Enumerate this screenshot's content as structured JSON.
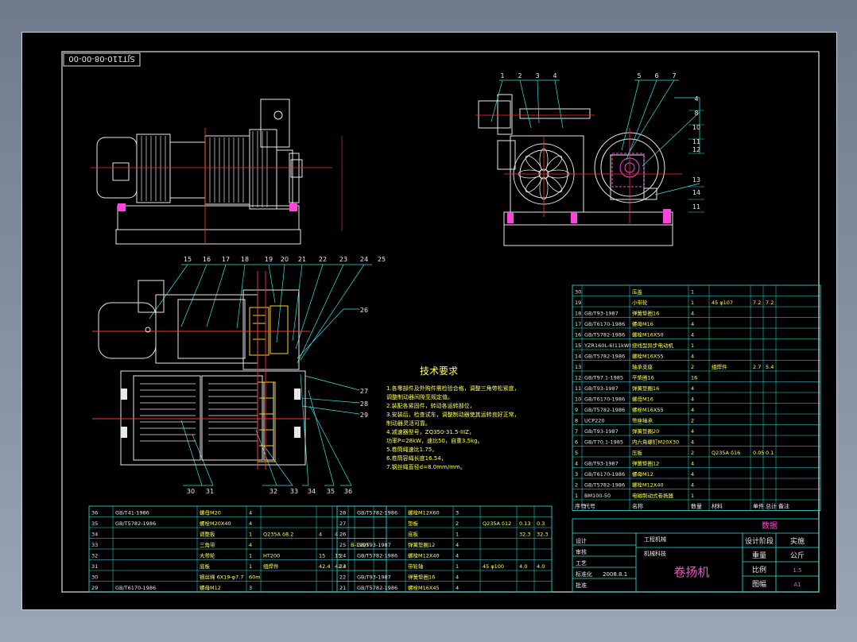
{
  "drawing_number": "SJT110-08-00-00",
  "balloons_top_left": [
    "1",
    "2",
    "3",
    "4"
  ],
  "balloons_top_mid": [
    "5",
    "6",
    "7"
  ],
  "balloons_right_side": [
    "4",
    "8",
    "10",
    "11",
    "12",
    "13",
    "14",
    "11"
  ],
  "balloons_plan_top": [
    "15",
    "16",
    "17",
    "18",
    "19",
    "20",
    "21",
    "22",
    "23",
    "24",
    "25"
  ],
  "balloons_plan_right": [
    "26",
    "27",
    "28",
    "29"
  ],
  "balloons_plan_bottom": [
    "30",
    "31",
    "32",
    "33",
    "34",
    "35",
    "36"
  ],
  "tech_req": {
    "title": "技术要求",
    "lines": [
      "1.各零部件及外购件需检验合格，调整三角带松紧度，",
      "  调整制动器间隙至规定值。",
      "2.装配各紧固件，转动各运转部位，",
      "3.安装后，检查试车，调整制动器使其运转良好正常，",
      "  制动器灵活可靠。",
      "4.减速器型号，ZQ350-31.5-IIIZ，",
      "  功率P=28kW，速比50，自重3.5kg。",
      "5.卷筒绳速比1.75，",
      "6.卷筒容绳长度16.54，",
      "7.钢丝绳直径d=8.0mm/mm。"
    ]
  },
  "bom_right": [
    {
      "no": "30",
      "code": "",
      "name": "压盖",
      "qty": "1",
      "mat": "",
      "w1": "",
      "w2": ""
    },
    {
      "no": "19",
      "code": "",
      "name": "小带轮",
      "qty": "1",
      "mat": "45 φ107",
      "w1": "7.2",
      "w2": "7.2"
    },
    {
      "no": "18",
      "code": "GB/T93-1987",
      "name": "弹簧垫圈16",
      "qty": "4",
      "mat": "",
      "w1": "",
      "w2": ""
    },
    {
      "no": "17",
      "code": "GB/T6170-1986",
      "name": "螺母M16",
      "qty": "4",
      "mat": "",
      "w1": "",
      "w2": ""
    },
    {
      "no": "16",
      "code": "GB/T5782-1986",
      "name": "螺栓M16X50",
      "qty": "4",
      "mat": "",
      "w1": "",
      "w2": ""
    },
    {
      "no": "15",
      "code": "YZR160L-6(11kW)",
      "name": "绕线型异步电动机",
      "qty": "1",
      "mat": "",
      "w1": "",
      "w2": ""
    },
    {
      "no": "14",
      "code": "GB/T5782-1986",
      "name": "螺栓M16X55",
      "qty": "4",
      "mat": "",
      "w1": "",
      "w2": ""
    },
    {
      "no": "13",
      "code": "",
      "name": "轴承支座",
      "qty": "2",
      "mat": "组焊件",
      "w1": "2.7",
      "w2": "5.4"
    },
    {
      "no": "12",
      "code": "GB/T97.1-1985",
      "name": "平垫圈16",
      "qty": "16",
      "mat": "",
      "w1": "",
      "w2": ""
    },
    {
      "no": "11",
      "code": "GB/T93-1987",
      "name": "弹簧垫圈16",
      "qty": "4",
      "mat": "",
      "w1": "",
      "w2": ""
    },
    {
      "no": "10",
      "code": "GB/T6170-1986",
      "name": "螺母M16",
      "qty": "4",
      "mat": "",
      "w1": "",
      "w2": ""
    },
    {
      "no": "9",
      "code": "GB/T5782-1986",
      "name": "螺栓M16X55",
      "qty": "4",
      "mat": "",
      "w1": "",
      "w2": ""
    },
    {
      "no": "8",
      "code": "UCP220",
      "name": "带座轴承",
      "qty": "2",
      "mat": "",
      "w1": "",
      "w2": ""
    },
    {
      "no": "7",
      "code": "GB/T93-1987",
      "name": "弹簧垫圈20",
      "qty": "4",
      "mat": "",
      "w1": "",
      "w2": ""
    },
    {
      "no": "6",
      "code": "GB/T70.1-1985",
      "name": "内六角螺钉M20X30",
      "qty": "4",
      "mat": "",
      "w1": "",
      "w2": ""
    },
    {
      "no": "5",
      "code": "",
      "name": "压板",
      "qty": "2",
      "mat": "Q235A δ16",
      "w1": "0.05",
      "w2": "0.1"
    },
    {
      "no": "4",
      "code": "GB/T93-1987",
      "name": "弹簧垫圈12",
      "qty": "4",
      "mat": "",
      "w1": "",
      "w2": ""
    },
    {
      "no": "3",
      "code": "GB/T6170-1986",
      "name": "螺母M12",
      "qty": "4",
      "mat": "",
      "w1": "",
      "w2": ""
    },
    {
      "no": "2",
      "code": "GB/T5782-1986",
      "name": "螺栓M12X40",
      "qty": "4",
      "mat": "",
      "w1": "",
      "w2": ""
    },
    {
      "no": "1",
      "code": "BM100-50",
      "name": "电磁制动式卷扬器",
      "qty": "1",
      "mat": "",
      "w1": "",
      "w2": ""
    }
  ],
  "bom_header": [
    "序号",
    "代号",
    "名称",
    "数量",
    "材料",
    "单件",
    "总计",
    "备注"
  ],
  "bom_header_extra": "重量",
  "bom_bottom_left": [
    {
      "no": "36",
      "code": "GB/T41-1986",
      "name": "螺母M20",
      "qty": "4",
      "mat": "",
      "a": "",
      "b": "",
      "c": ""
    },
    {
      "no": "35",
      "code": "GB/T5782-1986",
      "name": "螺栓M20X40",
      "qty": "4",
      "mat": "",
      "a": "",
      "b": "",
      "c": ""
    },
    {
      "no": "34",
      "code": "",
      "name": "调整板",
      "qty": "1",
      "mat": "Q235A δ8.2",
      "a": "4",
      "b": "4",
      "c": ""
    },
    {
      "no": "33",
      "code": "",
      "name": "三角带",
      "qty": "4",
      "mat": "",
      "a": "",
      "b": "",
      "c": "B-1995"
    },
    {
      "no": "32",
      "code": "",
      "name": "大带轮",
      "qty": "1",
      "mat": "HT200",
      "a": "15",
      "b": "15",
      "c": ""
    },
    {
      "no": "31",
      "code": "",
      "name": "底板",
      "qty": "1",
      "mat": "组焊件",
      "a": "42.4",
      "b": "42.4",
      "c": ""
    },
    {
      "no": "30",
      "code": "",
      "name": "钢丝绳 6X19-φ7.7",
      "qty": "60m",
      "mat": "",
      "a": "",
      "b": "",
      "c": ""
    },
    {
      "no": "29",
      "code": "GB/T6170-1986",
      "name": "螺母M12",
      "qty": "3",
      "mat": "",
      "a": "",
      "b": "",
      "c": ""
    }
  ],
  "bom_bottom_mid": [
    {
      "no": "28",
      "code": "GB/T5782-1986",
      "name": "螺栓M12X60",
      "qty": "3",
      "mat": "",
      "a": "",
      "b": ""
    },
    {
      "no": "27",
      "code": "",
      "name": "垫板",
      "qty": "2",
      "mat": "Q235A δ12",
      "a": "0.13",
      "b": "0.3"
    },
    {
      "no": "26",
      "code": "",
      "name": "底板",
      "qty": "1",
      "mat": "",
      "a": "32.3",
      "b": "32.3"
    },
    {
      "no": "25",
      "code": "GB/T93-1987",
      "name": "弹簧垫圈12",
      "qty": "4",
      "mat": "",
      "a": "",
      "b": ""
    },
    {
      "no": "24",
      "code": "GB/T5782-1986",
      "name": "螺栓M12X40",
      "qty": "4",
      "mat": "",
      "a": "",
      "b": ""
    },
    {
      "no": "23",
      "code": "",
      "name": "带轮轴",
      "qty": "1",
      "mat": "45 φ100",
      "a": "4.0",
      "b": "4.0"
    },
    {
      "no": "22",
      "code": "GB/T93-1987",
      "name": "弹簧垫圈16",
      "qty": "4",
      "mat": "",
      "a": "",
      "b": ""
    },
    {
      "no": "21",
      "code": "GB/T5782-1986",
      "name": "螺栓M16X45",
      "qty": "4",
      "mat": "",
      "a": "",
      "b": ""
    }
  ],
  "title_block": {
    "company": "工程机械",
    "unit": "机械科技",
    "product": "卷扬机",
    "stage_label": "设计阶段",
    "stage_value": "实施",
    "weight_label": "重量",
    "weight_value": "公斤",
    "scale_label": "比例",
    "scale_value": "1:5",
    "sheet_label": "图幅",
    "sheet_value": "A1",
    "roles": [
      "设计",
      "审核",
      "工艺",
      "标准化",
      "批准"
    ],
    "date_label": "2008.8.1",
    "drawing_title": "数据"
  }
}
